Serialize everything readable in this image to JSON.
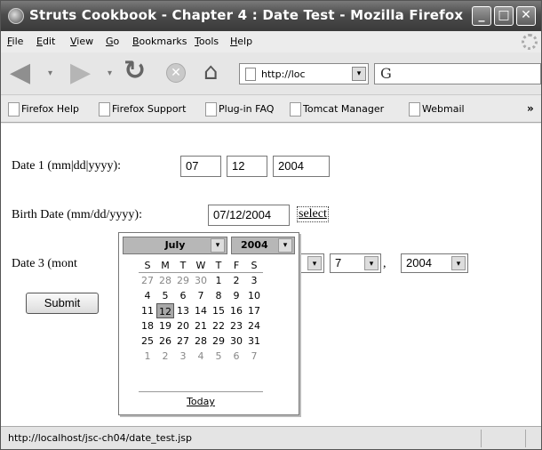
{
  "window": {
    "title": "Struts Cookbook - Chapter 4 : Date Test - Mozilla Firefox",
    "min_label": "_",
    "max_label": "□",
    "close_label": "✕"
  },
  "menu": {
    "items": [
      {
        "key": "F",
        "rest": "ile"
      },
      {
        "key": "E",
        "rest": "dit"
      },
      {
        "key": "V",
        "rest": "iew"
      },
      {
        "key": "G",
        "rest": "o"
      },
      {
        "key": "B",
        "rest": "ookmarks"
      },
      {
        "key": "T",
        "rest": "ools"
      },
      {
        "key": "H",
        "rest": "elp"
      }
    ]
  },
  "nav": {
    "url": "http://loc",
    "search_letter": "G"
  },
  "bookmarks": {
    "items": [
      "Firefox Help",
      "Firefox Support",
      "Plug-in FAQ",
      "Tomcat Manager",
      "Webmail"
    ],
    "more": "»"
  },
  "form": {
    "date1_label": "Date 1 (mm|dd|yyyy):",
    "date1_month": "07",
    "date1_day": "12",
    "date1_year": "2004",
    "birth_label": "Birth Date (mm/dd/yyyy):",
    "birth_value": "07/12/2004",
    "select_link": "select",
    "date3_label": "Date 3 (mont",
    "date3_day": "7",
    "date3_comma": ",",
    "date3_year": "2004",
    "submit_label": "Submit"
  },
  "calendar": {
    "month": "July",
    "year": "2004",
    "weekdays": [
      "S",
      "M",
      "T",
      "W",
      "T",
      "F",
      "S"
    ],
    "weeks": [
      [
        {
          "d": "27",
          "o": true
        },
        {
          "d": "28",
          "o": true
        },
        {
          "d": "29",
          "o": true
        },
        {
          "d": "30",
          "o": true
        },
        {
          "d": "1"
        },
        {
          "d": "2"
        },
        {
          "d": "3"
        }
      ],
      [
        {
          "d": "4"
        },
        {
          "d": "5"
        },
        {
          "d": "6"
        },
        {
          "d": "7"
        },
        {
          "d": "8"
        },
        {
          "d": "9"
        },
        {
          "d": "10"
        }
      ],
      [
        {
          "d": "11"
        },
        {
          "d": "12",
          "s": true
        },
        {
          "d": "13"
        },
        {
          "d": "14"
        },
        {
          "d": "15"
        },
        {
          "d": "16"
        },
        {
          "d": "17"
        }
      ],
      [
        {
          "d": "18"
        },
        {
          "d": "19"
        },
        {
          "d": "20"
        },
        {
          "d": "21"
        },
        {
          "d": "22"
        },
        {
          "d": "23"
        },
        {
          "d": "24"
        }
      ],
      [
        {
          "d": "25"
        },
        {
          "d": "26"
        },
        {
          "d": "27"
        },
        {
          "d": "28"
        },
        {
          "d": "29"
        },
        {
          "d": "30"
        },
        {
          "d": "31"
        }
      ],
      [
        {
          "d": "1",
          "o": true
        },
        {
          "d": "2",
          "o": true
        },
        {
          "d": "3",
          "o": true
        },
        {
          "d": "4",
          "o": true
        },
        {
          "d": "5",
          "o": true
        },
        {
          "d": "6",
          "o": true
        },
        {
          "d": "7",
          "o": true
        }
      ]
    ],
    "today_label": "Today"
  },
  "status": {
    "text": "http://localhost/jsc-ch04/date_test.jsp"
  },
  "icons": {
    "arrow": "▾",
    "back": "◀",
    "forward": "▶",
    "reload": "↻",
    "stop": "✕",
    "home": "⌂"
  }
}
